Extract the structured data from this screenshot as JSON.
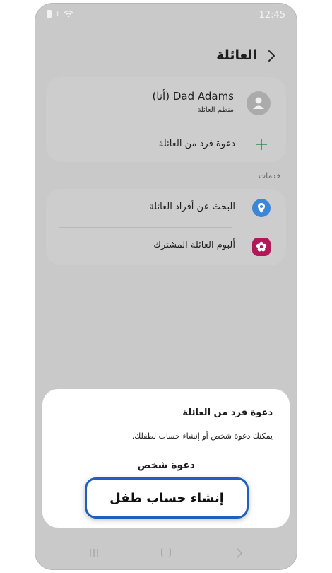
{
  "status_bar": {
    "time": "12:45"
  },
  "header": {
    "title": "العائلة"
  },
  "family": {
    "member_name": "Dad Adams (أنا)",
    "member_role": "منظم العائلة",
    "invite_label": "دعوة فرد من العائلة"
  },
  "services": {
    "section_label": "خدمات",
    "items": [
      {
        "label": "البحث عن أفراد العائلة",
        "icon": "location-pin-icon",
        "color": "#3b86d8"
      },
      {
        "label": "ألبوم العائلة المشترك",
        "icon": "flower-icon",
        "color": "#b0185a"
      }
    ]
  },
  "sheet": {
    "title": "دعوة فرد من العائلة",
    "description": "يمكنك دعوة شخص أو إنشاء حساب لطفلك.",
    "invite_person": "دعوة شخص",
    "create_child": "إنشاء حساب طفل"
  },
  "colors": {
    "accent_highlight": "#1f5fbf",
    "add_plus": "#2e8b57"
  }
}
